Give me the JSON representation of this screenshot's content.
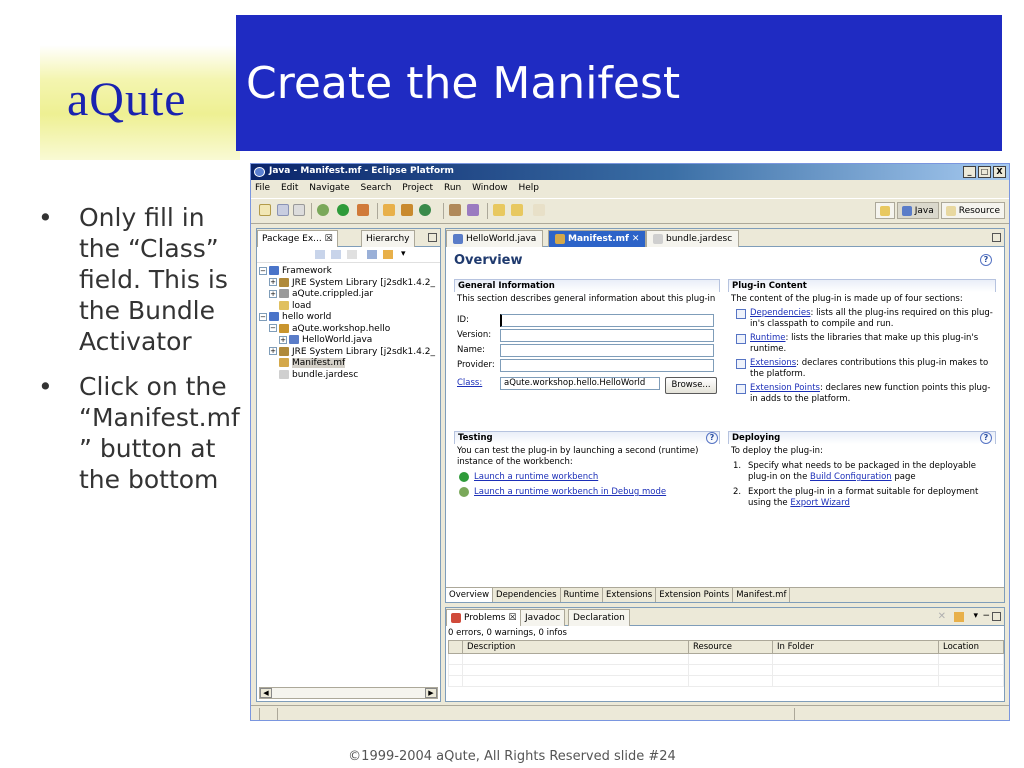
{
  "slide": {
    "logo": "aQute",
    "title": "Create the Manifest",
    "bullets": [
      "Only fill in the “Class” field. This is the Bundle Activator",
      "Click on the “Manifest.mf ” button at the bottom"
    ],
    "bullet_char": "•",
    "footer": "©1999-2004 aQute, All Rights Reserved  slide #24"
  },
  "window": {
    "title": "Java - Manifest.mf - Eclipse Platform",
    "controls": [
      "_",
      "□",
      "X"
    ],
    "menu": [
      "File",
      "Edit",
      "Navigate",
      "Search",
      "Project",
      "Run",
      "Window",
      "Help"
    ],
    "perspectives": [
      "Java",
      "Resource"
    ]
  },
  "explorer": {
    "tabs": [
      "Package Ex... ☒",
      "Hierarchy"
    ],
    "tree": [
      {
        "indent": 0,
        "exp": "−",
        "icon": "project-icon",
        "color": "#4a74c9",
        "label": "Framework"
      },
      {
        "indent": 1,
        "exp": "+",
        "icon": "library-icon",
        "color": "#b08a3a",
        "label": "JRE System Library [j2sdk1.4.2_"
      },
      {
        "indent": 1,
        "exp": "+",
        "icon": "jar-icon",
        "color": "#9a9a9a",
        "label": "aQute.crippled.jar"
      },
      {
        "indent": 1,
        "exp": "",
        "icon": "folder-icon",
        "color": "#e0c060",
        "label": "load"
      },
      {
        "indent": 0,
        "exp": "−",
        "icon": "project-icon",
        "color": "#4a74c9",
        "label": "hello world"
      },
      {
        "indent": 1,
        "exp": "−",
        "icon": "package-icon",
        "color": "#c9952e",
        "label": "aQute.workshop.hello"
      },
      {
        "indent": 2,
        "exp": "+",
        "icon": "java-file-icon",
        "color": "#5a7cc8",
        "label": "HelloWorld.java"
      },
      {
        "indent": 1,
        "exp": "+",
        "icon": "library-icon",
        "color": "#b08a3a",
        "label": "JRE System Library [j2sdk1.4.2_"
      },
      {
        "indent": 1,
        "exp": "",
        "icon": "manifest-icon",
        "color": "#d4a84a",
        "label": "Manifest.mf",
        "selected": true
      },
      {
        "indent": 1,
        "exp": "",
        "icon": "file-icon",
        "color": "#cfcfcf",
        "label": "bundle.jardesc"
      }
    ]
  },
  "editor": {
    "tabs": [
      "HelloWorld.java",
      "Manifest.mf",
      "bundle.jardesc"
    ],
    "active_tab": "Manifest.mf",
    "close_glyph": "✕",
    "heading": "Overview",
    "help": "?",
    "general": {
      "title": "General Information",
      "desc": "This section describes general information about this plug-in",
      "fields": [
        {
          "label": "ID:",
          "value": ""
        },
        {
          "label": "Version:",
          "value": ""
        },
        {
          "label": "Name:",
          "value": ""
        },
        {
          "label": "Provider:",
          "value": ""
        }
      ],
      "class_label": "Class:",
      "class_value": "aQute.workshop.hello.HelloWorld",
      "browse": "Browse..."
    },
    "plugin_content": {
      "title": "Plug-in Content",
      "desc": "The content of the plug-in is made up of four sections:",
      "items": [
        {
          "link": "Dependencies",
          "text": ": lists all the plug-ins required on this plug-in's classpath to compile and run."
        },
        {
          "link": "Runtime",
          "text": ": lists the libraries that make up this plug-in's runtime."
        },
        {
          "link": "Extensions",
          "text": ": declares contributions this plug-in makes to the platform."
        },
        {
          "link": "Extension Points",
          "text": ": declares new function points this plug-in adds to the platform."
        }
      ]
    },
    "testing": {
      "title": "Testing",
      "desc": "You can test the plug-in by launching a second (runtime) instance of the workbench:",
      "links": [
        "Launch a runtime workbench",
        "Launch a runtime workbench in Debug mode"
      ]
    },
    "deploying": {
      "title": "Deploying",
      "desc": "To deploy the plug-in:",
      "steps": [
        {
          "num": "1.",
          "pre": "Specify what needs to be packaged in the deployable plug-in on the ",
          "link": "Build Configuration",
          "post": " page"
        },
        {
          "num": "2.",
          "pre": "Export the plug-in in a format suitable for deployment using the ",
          "link": "Export Wizard",
          "post": ""
        }
      ]
    },
    "page_tabs": [
      "Overview",
      "Dependencies",
      "Runtime",
      "Extensions",
      "Extension Points",
      "Manifest.mf"
    ]
  },
  "problems": {
    "tabs": [
      "Problems ☒",
      "Javadoc",
      "Declaration"
    ],
    "status": "0 errors, 0 warnings, 0 infos",
    "columns": [
      "",
      "Description",
      "Resource",
      "In Folder",
      "Location"
    ]
  }
}
